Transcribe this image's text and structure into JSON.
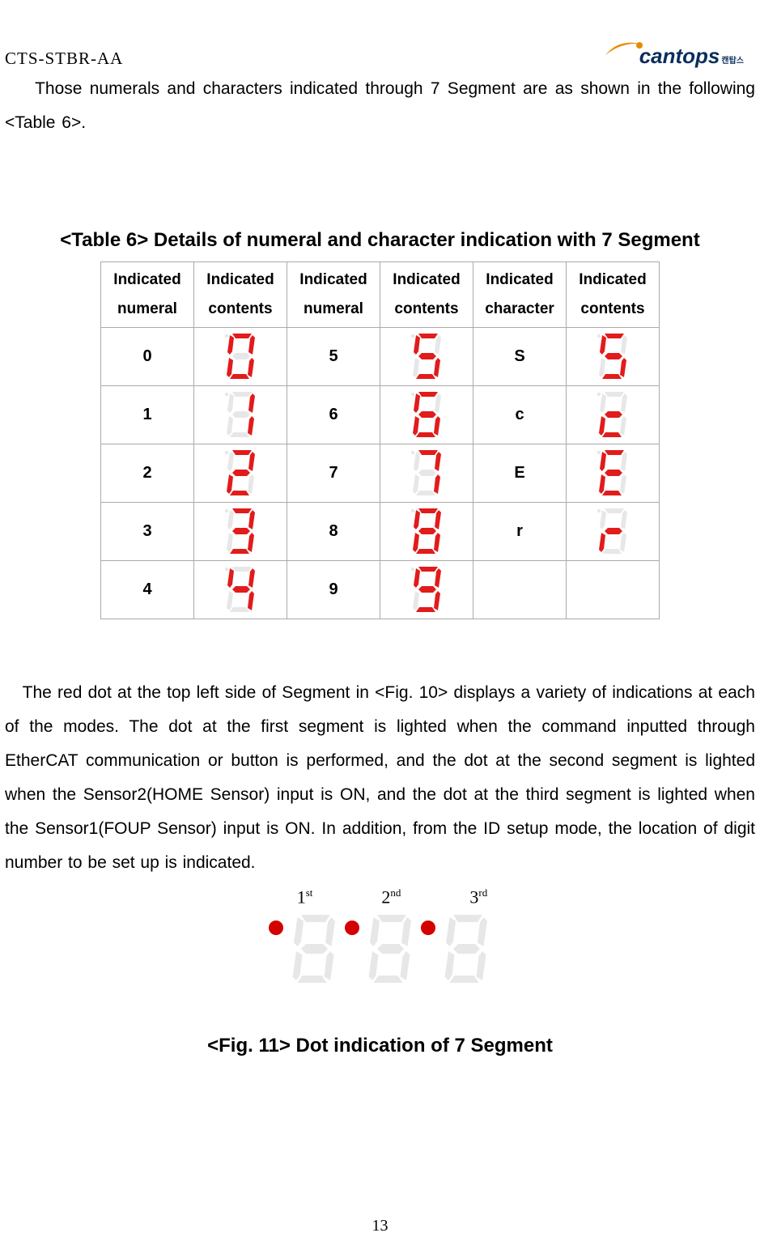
{
  "doc_code": "CTS-STBR-AA",
  "logo_text": "cantops",
  "logo_kr": "캔탑스",
  "intro_text": "Those numerals and characters indicated through 7 Segment are as shown in the following <Table 6>.",
  "table_title": "<Table 6> Details of numeral and character indication with 7 Segment",
  "headers": [
    "Indicated numeral",
    "Indicated contents",
    "Indicated numeral",
    "Indicated contents",
    "Indicated character",
    "Indicated contents"
  ],
  "rows": [
    {
      "c0": "0",
      "s0": "0",
      "c2": "5",
      "s2": "5",
      "c4": "S",
      "s4": "S"
    },
    {
      "c0": "1",
      "s0": "1",
      "c2": "6",
      "s2": "6",
      "c4": "c",
      "s4": "c"
    },
    {
      "c0": "2",
      "s0": "2",
      "c2": "7",
      "s2": "7",
      "c4": "E",
      "s4": "E"
    },
    {
      "c0": "3",
      "s0": "3",
      "c2": "8",
      "s2": "8",
      "c4": "r",
      "s4": "r"
    },
    {
      "c0": "4",
      "s0": "4",
      "c2": "9",
      "s2": "9",
      "c4": "",
      "s4": ""
    }
  ],
  "para2_text": "The red dot at the top left side of Segment in <Fig. 10> displays a variety of indications at each of the modes. The dot at the first segment is lighted when the command inputted through EtherCAT communication or button is performed, and the dot at the second segment is lighted when the Sensor2(HOME Sensor) input is ON, and the dot at the third segment is lighted when the Sensor1(FOUP Sensor) input is ON. In addition, from the ID setup mode, the location of digit number to be set up is indicated.",
  "fig11_labels": [
    "1st",
    "2nd",
    "3rd"
  ],
  "fig_caption": "<Fig. 11> Dot indication of 7 Segment",
  "page_number": "13",
  "chart_data": {
    "type": "table",
    "title": "<Table 6> Details of numeral and character indication with 7 Segment",
    "columns": [
      "Indicated numeral",
      "Indicated contents (7-seg)",
      "Indicated numeral",
      "Indicated contents (7-seg)",
      "Indicated character",
      "Indicated contents (7-seg)"
    ],
    "rows": [
      [
        "0",
        "0",
        "5",
        "5",
        "S",
        "S"
      ],
      [
        "1",
        "1",
        "6",
        "6",
        "c",
        "c"
      ],
      [
        "2",
        "2",
        "7",
        "7",
        "E",
        "E"
      ],
      [
        "3",
        "3",
        "8",
        "8",
        "r",
        "r"
      ],
      [
        "4",
        "4",
        "9",
        "9",
        "",
        ""
      ]
    ]
  }
}
